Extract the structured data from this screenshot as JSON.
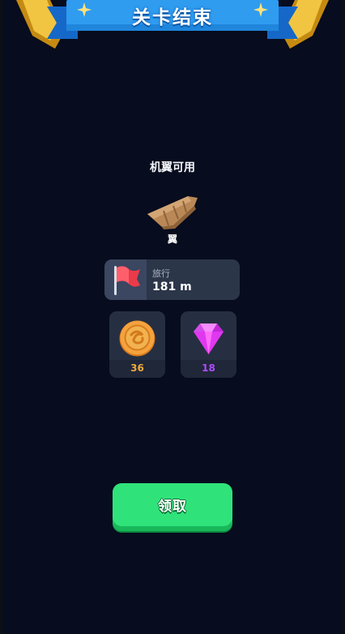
{
  "banner": {
    "title": "关卡结束"
  },
  "unlock": {
    "title": "机翼可用",
    "item_name": "翼"
  },
  "distance": {
    "label": "旅行",
    "value": "181 m"
  },
  "rewards": [
    {
      "icon": "coin-icon",
      "count": "36",
      "color": "#f0a93e"
    },
    {
      "icon": "gem-icon",
      "count": "18",
      "color": "#b04bff"
    }
  ],
  "actions": {
    "claim_label": "领取"
  },
  "colors": {
    "background": "#070c1e",
    "accent_green": "#2fe37a",
    "banner_blue": "#2f9cf0"
  }
}
